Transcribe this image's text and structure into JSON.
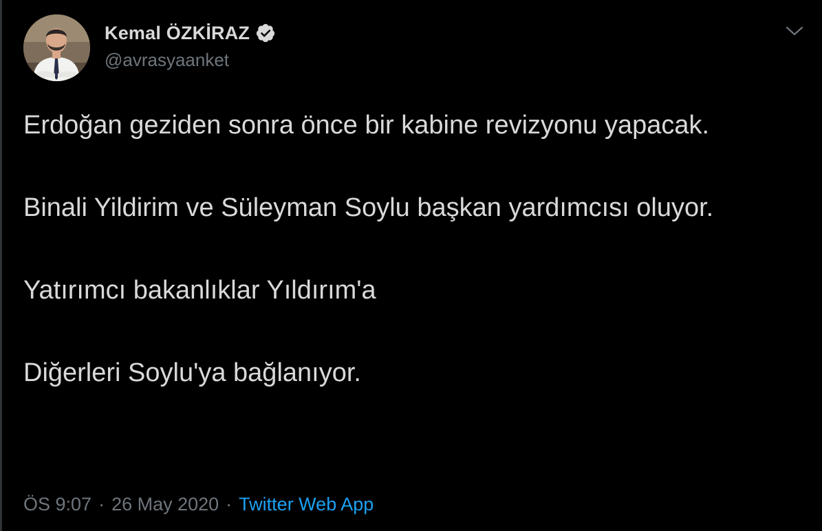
{
  "tweet": {
    "author": {
      "display_name": "Kemal ÖZKİRAZ",
      "handle": "@avrasyaanket",
      "verified_icon": "verified-badge-icon"
    },
    "more_icon": "chevron-down-icon",
    "paragraphs": [
      "Erdoğan geziden sonra önce bir kabine revizyonu yapacak.",
      "Binali Yildirim ve Süleyman Soylu başkan yardımcısı oluyor.",
      "Yatırımcı bakanlıklar Yıldırım'a",
      "Diğerleri Soylu'ya bağlanıyor."
    ],
    "meta": {
      "time": "ÖS 9:07",
      "separator": "·",
      "date": "26 May 2020",
      "source": "Twitter Web App"
    }
  },
  "colors": {
    "background": "#000000",
    "text": "#d9d9d9",
    "muted": "#6e767d",
    "link": "#1da1f2"
  }
}
